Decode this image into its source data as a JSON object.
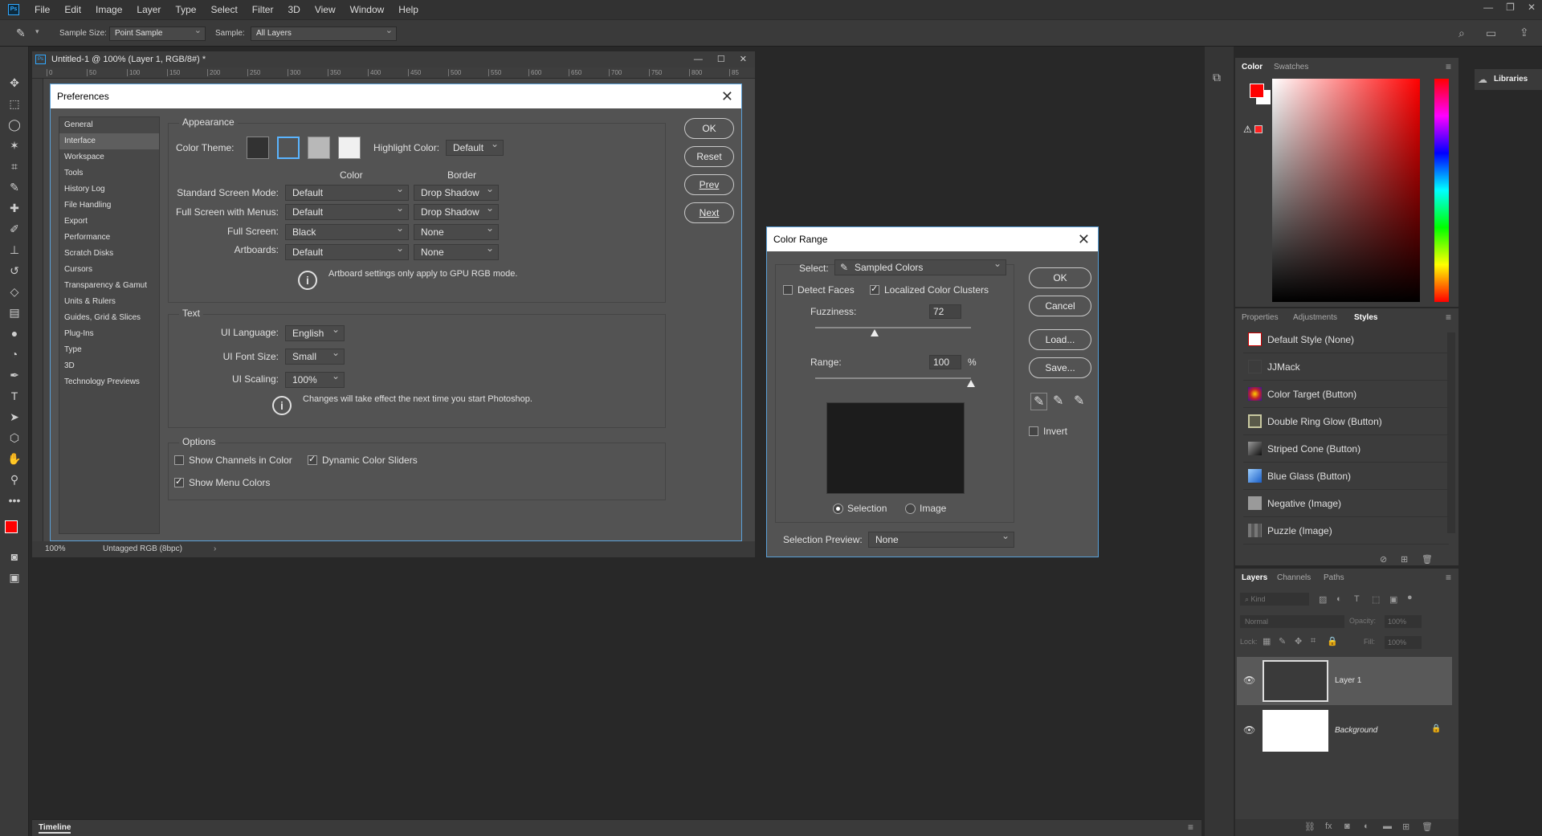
{
  "app": {
    "menu": [
      "File",
      "Edit",
      "Image",
      "Layer",
      "Type",
      "Select",
      "Filter",
      "3D",
      "View",
      "Window",
      "Help"
    ],
    "logo": "Ps"
  },
  "options_bar": {
    "sample_size_label": "Sample Size:",
    "sample_size_value": "Point Sample",
    "sample_label": "Sample:",
    "sample_value": "All Layers"
  },
  "document": {
    "title": "Untitled-1 @ 100% (Layer 1, RGB/8#) *",
    "ruler_ticks": [
      "0",
      "50",
      "100",
      "150",
      "200",
      "250",
      "300",
      "350",
      "400",
      "450",
      "500",
      "550",
      "600",
      "650",
      "700",
      "750",
      "800",
      "85"
    ],
    "zoom": "100%",
    "profile": "Untagged RGB (8bpc)"
  },
  "preferences": {
    "title": "Preferences",
    "nav": [
      "General",
      "Interface",
      "Workspace",
      "Tools",
      "History Log",
      "File Handling",
      "Export",
      "Performance",
      "Scratch Disks",
      "Cursors",
      "Transparency & Gamut",
      "Units & Rulers",
      "Guides, Grid & Slices",
      "Plug-Ins",
      "Type",
      "3D",
      "Technology Previews"
    ],
    "active_nav": "Interface",
    "appearance": {
      "legend": "Appearance",
      "color_theme_label": "Color Theme:",
      "theme_colors": [
        "#323232",
        "#535353",
        "#b8b8b8",
        "#f0f0f0"
      ],
      "highlight_label": "Highlight Color:",
      "highlight_value": "Default",
      "col_color": "Color",
      "col_border": "Border",
      "rows": [
        {
          "label": "Standard Screen Mode:",
          "color": "Default",
          "border": "Drop Shadow"
        },
        {
          "label": "Full Screen with Menus:",
          "color": "Default",
          "border": "Drop Shadow"
        },
        {
          "label": "Full Screen:",
          "color": "Black",
          "border": "None"
        },
        {
          "label": "Artboards:",
          "color": "Default",
          "border": "None"
        }
      ],
      "artboard_note": "Artboard settings only apply to GPU RGB mode."
    },
    "text": {
      "legend": "Text",
      "ui_language_label": "UI Language:",
      "ui_language": "English",
      "ui_font_size_label": "UI Font Size:",
      "ui_font_size": "Small",
      "ui_scaling_label": "UI Scaling:",
      "ui_scaling": "100%",
      "note": "Changes will take effect the next time you start Photoshop."
    },
    "options": {
      "legend": "Options",
      "show_channels": "Show Channels in Color",
      "dynamic_sliders": "Dynamic Color Sliders",
      "show_menu_colors": "Show Menu Colors"
    },
    "buttons": {
      "ok": "OK",
      "reset": "Reset",
      "prev": "Prev",
      "next": "Next"
    }
  },
  "color_range": {
    "title": "Color Range",
    "select_label": "Select:",
    "select_value": "Sampled Colors",
    "detect_faces": "Detect Faces",
    "localized": "Localized Color Clusters",
    "fuzziness_label": "Fuzziness:",
    "fuzziness": "72",
    "range_label": "Range:",
    "range": "100",
    "range_unit": "%",
    "selection_radio": "Selection",
    "image_radio": "Image",
    "preview_label": "Selection Preview:",
    "preview_value": "None",
    "invert": "Invert",
    "buttons": {
      "ok": "OK",
      "cancel": "Cancel",
      "load": "Load...",
      "save": "Save..."
    }
  },
  "panels": {
    "color_tabs": [
      "Color",
      "Swatches"
    ],
    "libraries": "Libraries",
    "props_tabs": [
      "Properties",
      "Adjustments",
      "Styles"
    ],
    "styles": [
      {
        "name": "Default Style (None)",
        "icon": "#ffffff"
      },
      {
        "name": "JJMack",
        "icon": "#3c3c3c"
      },
      {
        "name": "Color Target (Button)",
        "icon": "#c0202a"
      },
      {
        "name": "Double Ring Glow (Button)",
        "icon": "#8a8a70"
      },
      {
        "name": "Striped Cone (Button)",
        "icon": "#222222"
      },
      {
        "name": "Blue Glass (Button)",
        "icon": "#2a7fd8"
      },
      {
        "name": "Negative (Image)",
        "icon": "#9a9a9a"
      },
      {
        "name": "Puzzle (Image)",
        "icon": "#777777"
      }
    ],
    "layers_tabs": [
      "Layers",
      "Channels",
      "Paths"
    ],
    "kind": "Kind",
    "blend": "Normal",
    "opacity_label": "Opacity:",
    "opacity": "100%",
    "lock_label": "Lock:",
    "fill_label": "Fill:",
    "fill": "100%",
    "layers": [
      {
        "name": "Layer 1"
      },
      {
        "name": "Background"
      }
    ],
    "timeline": "Timeline"
  }
}
